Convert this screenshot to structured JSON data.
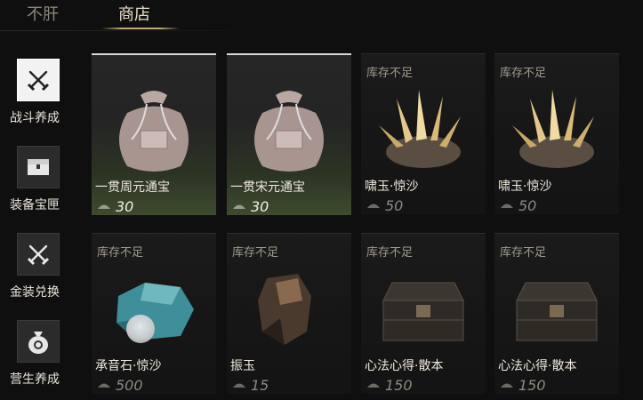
{
  "tabs": [
    {
      "label": "不肝",
      "active": false
    },
    {
      "label": "商店",
      "active": true
    }
  ],
  "nav": [
    {
      "label": "战斗养成",
      "icon": "crossed-swords-icon",
      "active": true
    },
    {
      "label": "装备宝匣",
      "icon": "treasure-chest-icon",
      "active": false
    },
    {
      "label": "金装兑换",
      "icon": "crossed-swords-icon",
      "active": false
    },
    {
      "label": "营生养成",
      "icon": "money-bag-icon",
      "active": false
    }
  ],
  "items": [
    {
      "name": "一贯周元通宝",
      "price": "30",
      "stock": "",
      "art": "cloth-pouch"
    },
    {
      "name": "一贯宋元通宝",
      "price": "30",
      "stock": "",
      "art": "cloth-pouch"
    },
    {
      "name": "啸玉·惊沙",
      "price": "50",
      "stock": "库存不足",
      "art": "crystal-cluster"
    },
    {
      "name": "啸玉·惊沙",
      "price": "50",
      "stock": "库存不足",
      "art": "crystal-cluster"
    },
    {
      "name": "承音石·惊沙",
      "price": "500",
      "stock": "库存不足",
      "art": "blue-stone"
    },
    {
      "name": "振玉",
      "price": "15",
      "stock": "库存不足",
      "art": "dark-ore"
    },
    {
      "name": "心法心得·散本",
      "price": "150",
      "stock": "库存不足",
      "art": "dark-chest"
    },
    {
      "name": "心法心得·散本",
      "price": "150",
      "stock": "库存不足",
      "art": "dark-chest"
    }
  ],
  "colors": {
    "accent": "#c6a977",
    "affordable_bg": "#3e4b2e",
    "card_bg": "#161616"
  }
}
